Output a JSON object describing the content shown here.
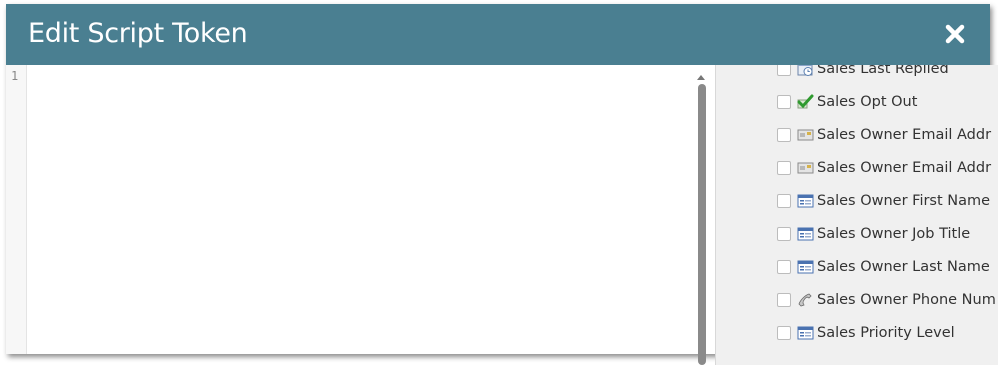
{
  "dialog": {
    "title": "Edit Script Token",
    "close_icon": "close-x-icon"
  },
  "editor": {
    "line_numbers": [
      "1"
    ],
    "content": ""
  },
  "fields": [
    {
      "label": "Sales Last Replied",
      "icon": "calendar-icon",
      "checked": false
    },
    {
      "label": "Sales Opt Out",
      "icon": "checkmark-icon",
      "checked": false
    },
    {
      "label": "Sales Owner Email Addr",
      "icon": "email-card-icon",
      "checked": false
    },
    {
      "label": "Sales Owner Email Addr",
      "icon": "email-card-icon",
      "checked": false
    },
    {
      "label": "Sales Owner First Name",
      "icon": "text-field-icon",
      "checked": false
    },
    {
      "label": "Sales Owner Job Title",
      "icon": "text-field-icon",
      "checked": false
    },
    {
      "label": "Sales Owner Last Name",
      "icon": "text-field-icon",
      "checked": false
    },
    {
      "label": "Sales Owner Phone Num",
      "icon": "phone-icon",
      "checked": false
    },
    {
      "label": "Sales Priority Level",
      "icon": "text-field-icon",
      "checked": false
    }
  ],
  "colors": {
    "titlebar": "#4a7f91",
    "panel": "#f0f0f0"
  }
}
